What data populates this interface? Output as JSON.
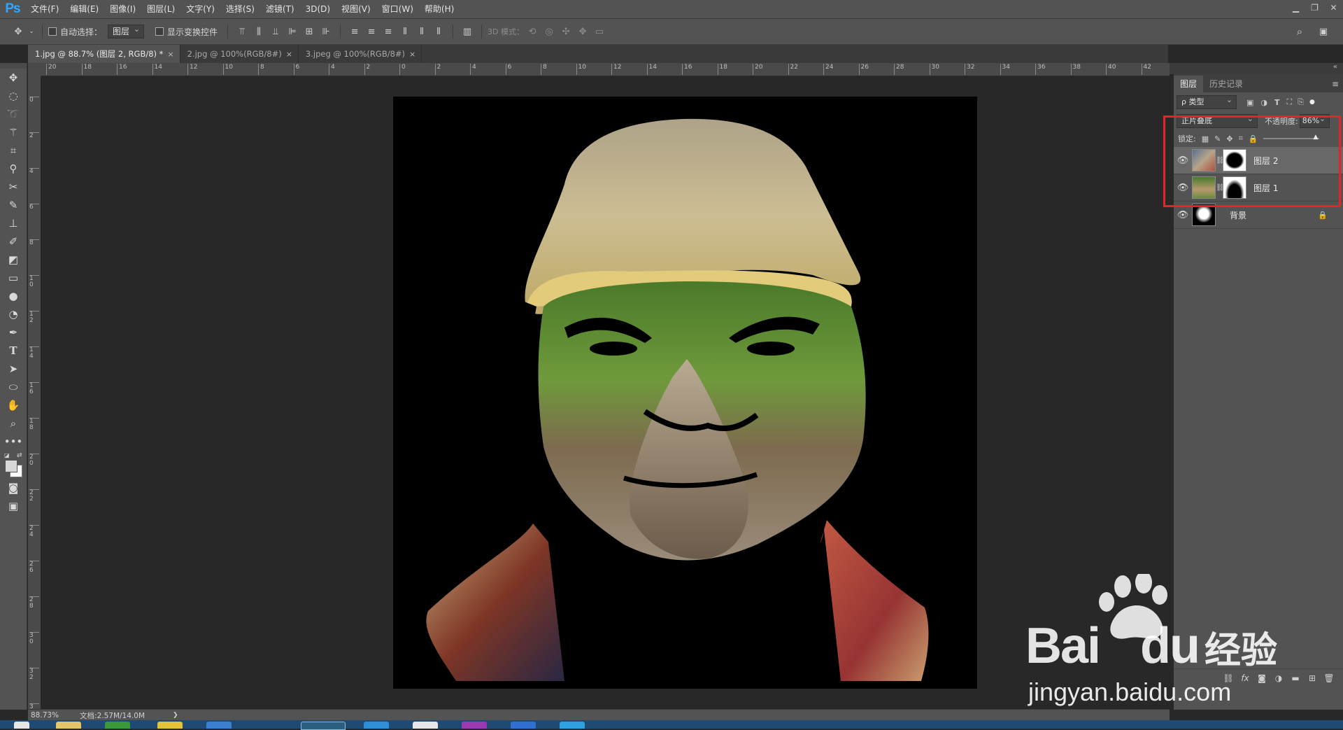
{
  "app": {
    "logo": "Ps"
  },
  "menu": [
    "文件(F)",
    "编辑(E)",
    "图像(I)",
    "图层(L)",
    "文字(Y)",
    "选择(S)",
    "滤镜(T)",
    "3D(D)",
    "视图(V)",
    "窗口(W)",
    "帮助(H)"
  ],
  "options": {
    "auto_select_label": "自动选择：",
    "auto_select_value": "图层",
    "show_transform_label": "显示变换控件",
    "mode_3d_label": "3D 模式："
  },
  "tabs": [
    {
      "label": "1.jpg @ 88.7% (图层 2, RGB/8) *",
      "active": true
    },
    {
      "label": "2.jpg @ 100%(RGB/8#)",
      "active": false
    },
    {
      "label": "3.jpeg @ 100%(RGB/8#)",
      "active": false
    }
  ],
  "ruler_top": [
    "20",
    "18",
    "16",
    "14",
    "12",
    "10",
    "8",
    "6",
    "4",
    "2",
    "0",
    "2",
    "4",
    "6",
    "8",
    "10",
    "12",
    "14",
    "16",
    "18",
    "20",
    "22",
    "24",
    "26",
    "28",
    "30",
    "32",
    "34",
    "36",
    "38",
    "40",
    "42"
  ],
  "ruler_left": [
    "0",
    "2",
    "4",
    "6",
    "8",
    "1 0",
    "1 2",
    "1 4",
    "1 6",
    "1 8",
    "2 0",
    "2 2",
    "2 4",
    "2 6",
    "2 8",
    "3 0",
    "3 2",
    "3 4"
  ],
  "layers_panel": {
    "tabs": [
      "图层",
      "历史记录"
    ],
    "filter_label": "ρ 类型",
    "blend_mode": "正片叠底",
    "opacity_label": "不透明度:",
    "opacity_value": "86%",
    "lock_label": "锁定:",
    "layers": [
      {
        "name": "图层 2",
        "selected": true,
        "has_mask": true
      },
      {
        "name": "图层 1",
        "selected": false,
        "has_mask": true
      },
      {
        "name": "背景",
        "selected": false,
        "locked": true
      }
    ]
  },
  "status": {
    "zoom": "88.73%",
    "doc": "文档:2.57M/14.0M"
  },
  "watermark": {
    "brand": "Bai",
    "brand2": "du",
    "cn": "经验",
    "url": "jingyan.baidu.com"
  },
  "colors": {
    "accent": "#31a8ff",
    "highlight_box": "#e9222a",
    "ui_bg": "#535353",
    "canvas_bg": "#282828"
  }
}
